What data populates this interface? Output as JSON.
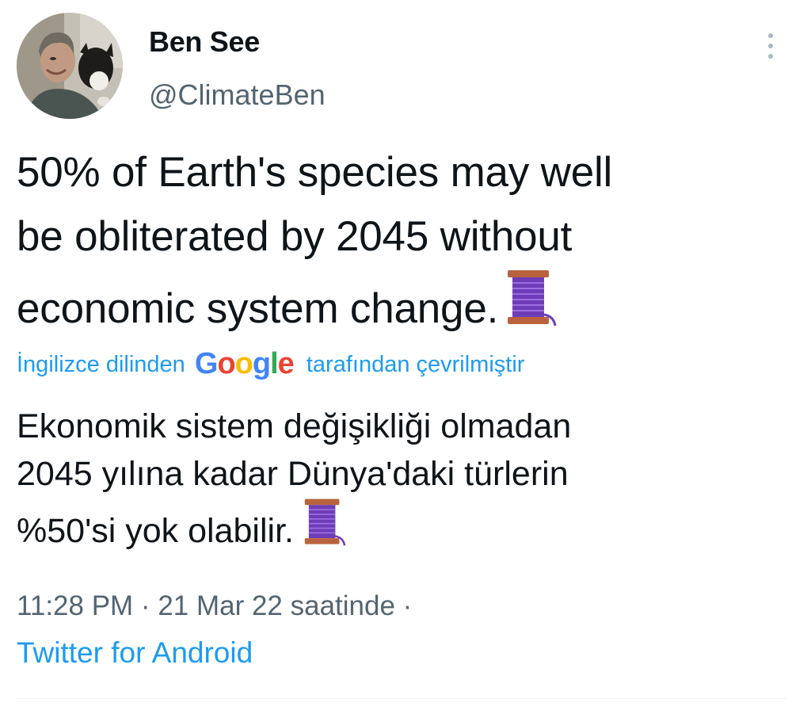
{
  "author": {
    "display_name": "Ben See",
    "handle": "@ClimateBen"
  },
  "tweet": {
    "text_lines": [
      "50% of Earth's species may well",
      "be obliterated by 2045 without",
      "economic system change."
    ],
    "emoji": "spool-of-thread"
  },
  "translation": {
    "prefix": "İngilizce dilinden",
    "brand_letters": [
      "G",
      "o",
      "o",
      "g",
      "l",
      "e"
    ],
    "suffix": "tarafından çevrilmiştir",
    "text_lines": [
      "Ekonomik sistem değişikliği olmadan",
      "2045 yılına kadar Dünya'daki türlerin",
      "%50'si yok olabilir."
    ]
  },
  "meta": {
    "timestamp": "11:28 PM · 21 Mar 22 saatinde ·",
    "source": "Twitter for Android"
  },
  "icons": {
    "more": "more-vertical-icon"
  },
  "colors": {
    "text": "#0f1419",
    "secondary": "#536471",
    "link": "#1d9bf0",
    "divider": "#eff3f4"
  }
}
